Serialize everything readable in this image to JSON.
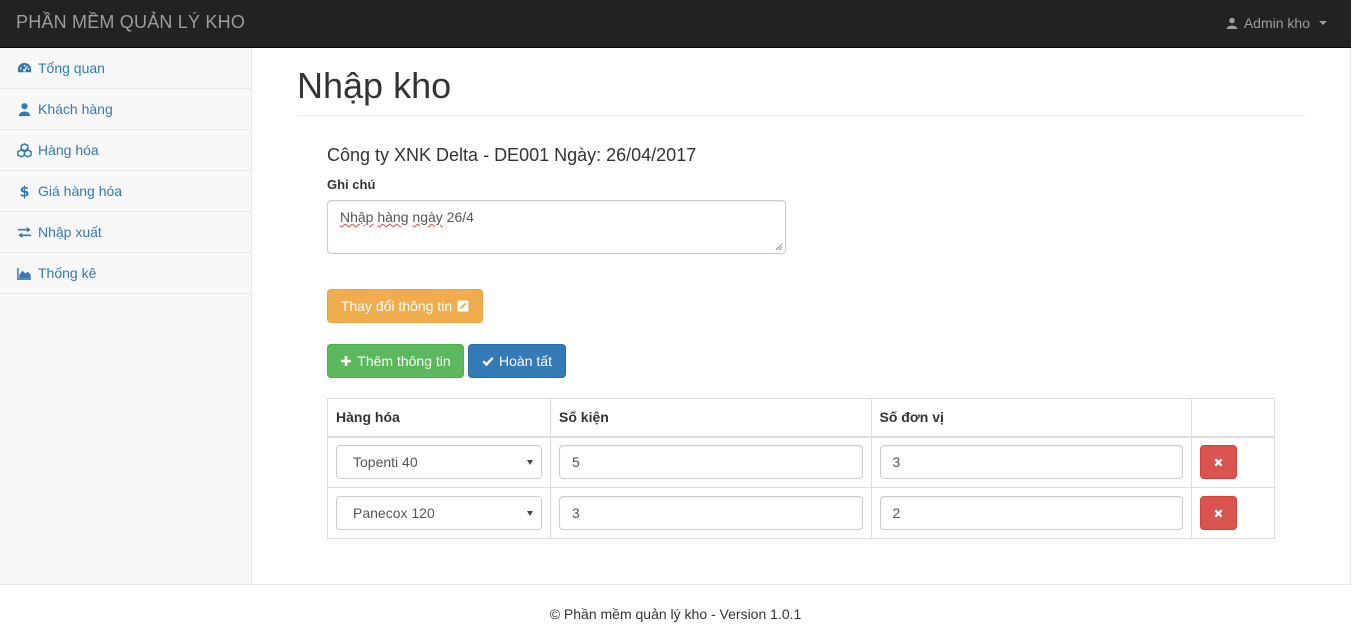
{
  "app": {
    "brand": "PHẦN MỀM QUẢN LÝ KHO",
    "user_label": "Admin kho"
  },
  "sidebar": {
    "items": [
      {
        "label": "Tổng quan",
        "icon": "dashboard-icon"
      },
      {
        "label": "Khách hàng",
        "icon": "user-icon"
      },
      {
        "label": "Hàng hóa",
        "icon": "cubes-icon"
      },
      {
        "label": "Giá hàng hóa",
        "icon": "dollar-icon"
      },
      {
        "label": "Nhập xuất",
        "icon": "exchange-icon"
      },
      {
        "label": "Thống kê",
        "icon": "area-chart-icon"
      }
    ]
  },
  "page": {
    "title": "Nhập kho",
    "company_line": "Công ty XNK Delta - DE001 Ngày: 26/04/2017",
    "note_label": "Ghi chú",
    "note_value_spell1": "Nhập",
    "note_value_spell2": "hàng",
    "note_value_spell3": "ngày",
    "note_value_rest": "26/4"
  },
  "buttons": {
    "edit_info": "Thay đổi thông tin",
    "add_info": "Thêm thông tin",
    "finish": "Hoàn tất"
  },
  "table": {
    "headers": [
      "Hàng hóa",
      "Số kiện",
      "Số đơn vị",
      ""
    ],
    "rows": [
      {
        "product": "Topenti 40",
        "packages": "5",
        "units": "3"
      },
      {
        "product": "Panecox 120",
        "packages": "3",
        "units": "2"
      }
    ]
  },
  "footer": {
    "text": "© Phần mềm quản lý kho - Version 1.0.1"
  },
  "colors": {
    "navbar_bg": "#222222",
    "link": "#337ab7",
    "warning": "#f0ad4e",
    "success": "#5cb85c",
    "primary": "#337ab7",
    "danger": "#d9534f"
  }
}
